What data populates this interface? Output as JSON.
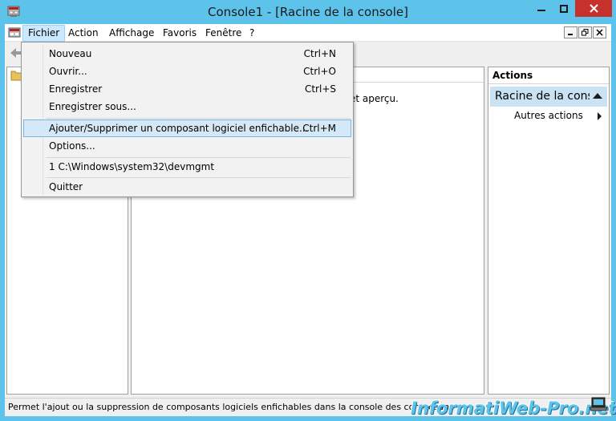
{
  "window": {
    "title": "Console1 - [Racine de la console]"
  },
  "menubar": {
    "items": [
      {
        "label": "Fichier"
      },
      {
        "label": "Action"
      },
      {
        "label": "Affichage"
      },
      {
        "label": "Favoris"
      },
      {
        "label": "Fenêtre"
      },
      {
        "label": "?"
      }
    ]
  },
  "file_menu": {
    "items": [
      {
        "label": "Nouveau",
        "shortcut": "Ctrl+N"
      },
      {
        "label": "Ouvrir...",
        "shortcut": "Ctrl+O"
      },
      {
        "label": "Enregistrer",
        "shortcut": "Ctrl+S"
      },
      {
        "label": "Enregistrer sous...",
        "shortcut": ""
      },
      {
        "label": "Ajouter/Supprimer un composant logiciel enfichable...",
        "shortcut": "Ctrl+M"
      },
      {
        "label": "Options...",
        "shortcut": ""
      },
      {
        "label": "1 C:\\Windows\\system32\\devmgmt",
        "shortcut": ""
      },
      {
        "label": "Quitter",
        "shortcut": ""
      }
    ]
  },
  "center_pane": {
    "text": "et aperçu."
  },
  "actions_pane": {
    "header": "Actions",
    "section": "Racine de la console",
    "more": "Autres actions"
  },
  "statusbar": {
    "text": "Permet l'ajout ou la suppression de composants logiciels enfichables dans la console des composants"
  },
  "watermark": {
    "text": "InformatiWeb-Pro.net"
  },
  "colors": {
    "frame": "#5ec3ea",
    "close_button": "#c7312d",
    "menu_active": "#cce8ff",
    "section_highlight": "#c9e3f5"
  }
}
